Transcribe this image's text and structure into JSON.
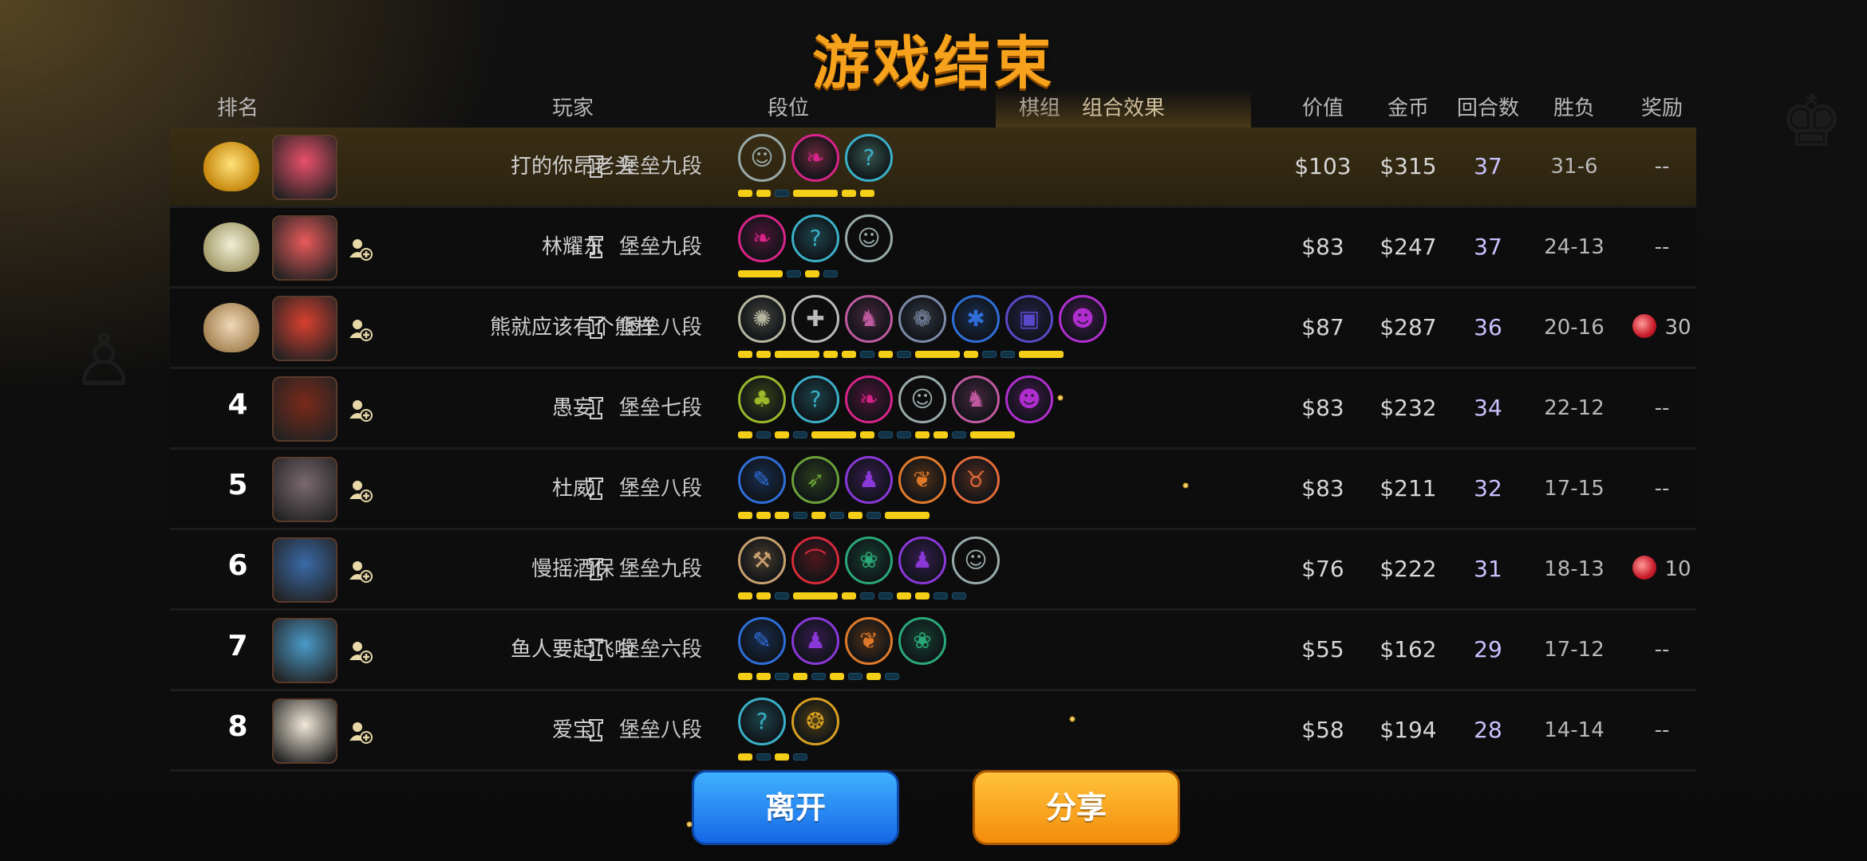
{
  "title": "游戏结束",
  "columns": {
    "rank": "排名",
    "player": "玩家",
    "tier": "段位",
    "chess_set": "棋组",
    "combo": "组合效果",
    "value": "价值",
    "gold": "金币",
    "rounds": "回合数",
    "win_loss": "胜负",
    "reward": "奖励"
  },
  "rows": [
    {
      "rank": "",
      "medal": "gold",
      "name": "打的你昂老头",
      "tier": "堡垒九段",
      "value": "$103",
      "gold": "$315",
      "rounds": "37",
      "win_loss": "31-6",
      "reward": "--"
    },
    {
      "rank": "",
      "medal": "silver",
      "name": "林耀东",
      "tier": "堡垒九段",
      "value": "$83",
      "gold": "$247",
      "rounds": "37",
      "win_loss": "24-13",
      "reward": "--"
    },
    {
      "rank": "",
      "medal": "bronze",
      "name": "熊就应该有个熊样",
      "tier": "堡垒八段",
      "value": "$87",
      "gold": "$287",
      "rounds": "36",
      "win_loss": "20-16",
      "reward": "30"
    },
    {
      "rank": "4",
      "medal": "",
      "name": "愚妄",
      "tier": "堡垒七段",
      "value": "$83",
      "gold": "$232",
      "rounds": "34",
      "win_loss": "22-12",
      "reward": "--"
    },
    {
      "rank": "5",
      "medal": "",
      "name": "杜威",
      "tier": "堡垒八段",
      "value": "$83",
      "gold": "$211",
      "rounds": "32",
      "win_loss": "17-15",
      "reward": "--"
    },
    {
      "rank": "6",
      "medal": "",
      "name": "慢摇酒保",
      "tier": "堡垒九段",
      "value": "$76",
      "gold": "$222",
      "rounds": "31",
      "win_loss": "18-13",
      "reward": "10"
    },
    {
      "rank": "7",
      "medal": "",
      "name": "鱼人要起飞啦",
      "tier": "堡垒六段",
      "value": "$55",
      "gold": "$162",
      "rounds": "29",
      "win_loss": "17-12",
      "reward": "--"
    },
    {
      "rank": "8",
      "medal": "",
      "name": "爱宝",
      "tier": "堡垒八段",
      "value": "$58",
      "gold": "$194",
      "rounds": "28",
      "win_loss": "14-14",
      "reward": "--"
    }
  ],
  "buttons": {
    "leave": "离开",
    "share": "分享"
  }
}
